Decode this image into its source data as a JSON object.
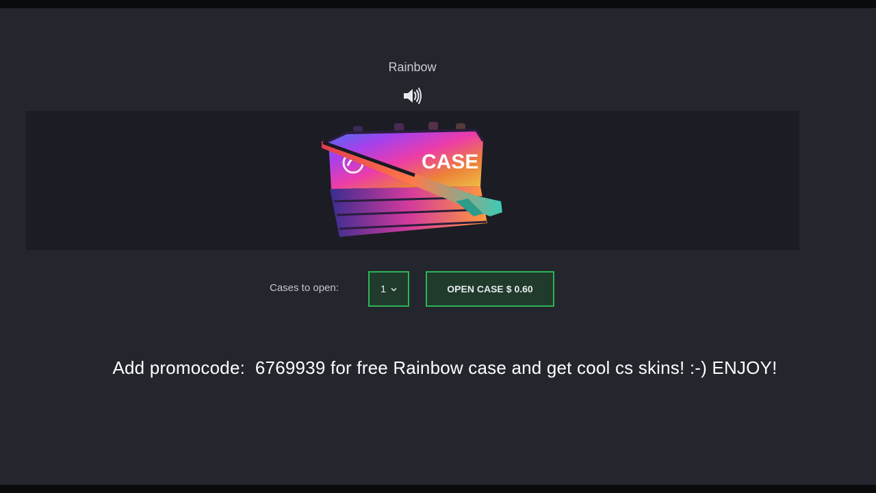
{
  "case": {
    "title": "Rainbow",
    "image_label": "CASE"
  },
  "icons": {
    "sound": "speaker-volume-icon",
    "dropdown": "chevron-down-icon"
  },
  "controls": {
    "cases_label": "Cases to open:",
    "quantity_value": "1",
    "open_label": "OPEN CASE",
    "price": "$ 0.60"
  },
  "promo": {
    "text": "Add promocode:  6769939 for free Rainbow case and get cool cs skins! :-) ENJOY!"
  },
  "colors": {
    "background": "#23262d",
    "banner": "#1b1c24",
    "accent_border": "#2fb457",
    "button_fill": "#203a2c"
  }
}
